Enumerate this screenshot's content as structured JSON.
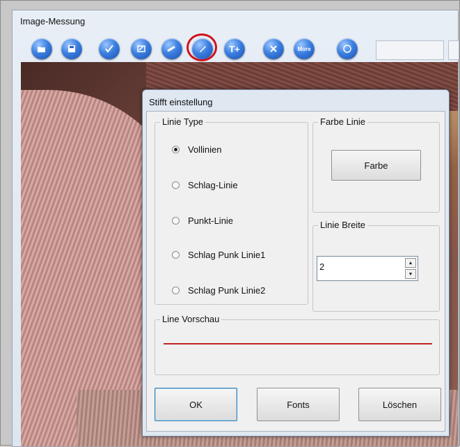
{
  "app": {
    "title": "Image-Messung"
  },
  "toolbar": {
    "buttons": [
      {
        "icon": "open-icon"
      },
      {
        "icon": "save-icon"
      },
      {
        "icon": "check-icon"
      },
      {
        "icon": "edit-box-icon"
      },
      {
        "icon": "ruler-icon"
      },
      {
        "icon": "pen-icon"
      },
      {
        "icon": "text-add-icon",
        "glyph": "T+"
      },
      {
        "icon": "delete-icon"
      },
      {
        "icon": "more-icon",
        "glyph": "More"
      },
      {
        "icon": "zoom-icon"
      }
    ],
    "highlight_color": "#d0121b"
  },
  "dialog": {
    "title": "Stifft einstellung",
    "line_type": {
      "legend": "Linie Type",
      "options": [
        "Vollinien",
        "Schlag-Linie",
        "Punkt-Linie",
        "Schlag Punk Linie1",
        "Schlag Punk Linie2"
      ],
      "selected": "Vollinien"
    },
    "color": {
      "legend": "Farbe Linie",
      "button_label": "Farbe"
    },
    "width": {
      "legend": "Linie Breite",
      "value": "2"
    },
    "preview": {
      "legend": "Line Vorschau",
      "line_color": "#c0231f"
    },
    "buttons": {
      "ok": "OK",
      "fonts": "Fonts",
      "delete": "Löschen"
    }
  }
}
